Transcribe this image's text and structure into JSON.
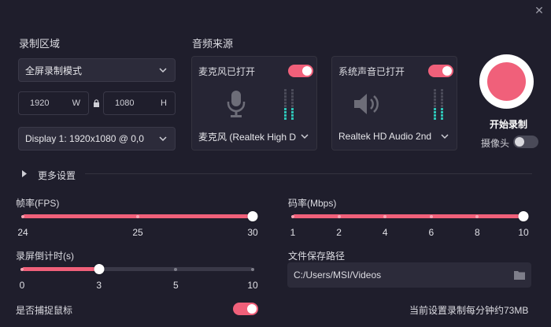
{
  "recording": {
    "section_title": "录制区域",
    "mode": "全屏录制模式",
    "width": "1920",
    "width_unit": "W",
    "height": "1080",
    "height_unit": "H",
    "display": "Display 1: 1920x1080 @ 0,0"
  },
  "audio": {
    "section_title": "音频来源",
    "mic": {
      "status": "麦克风已打开",
      "enabled": true,
      "device": "麦克风 (Realtek High D"
    },
    "system": {
      "status": "系统声音已打开",
      "enabled": true,
      "device": "Realtek HD Audio 2nd"
    }
  },
  "record": {
    "label": "开始录制",
    "camera_label": "摄像头",
    "camera_enabled": false
  },
  "more_settings": {
    "label": "更多设置"
  },
  "fps": {
    "label": "帧率(FPS)",
    "ticks": [
      "24",
      "25",
      "30"
    ],
    "value": "30"
  },
  "bitrate": {
    "label": "码率(Mbps)",
    "ticks": [
      "1",
      "2",
      "4",
      "6",
      "8",
      "10"
    ],
    "value": "10"
  },
  "countdown": {
    "label": "录屏倒计时(s)",
    "ticks": [
      "0",
      "3",
      "5",
      "10"
    ],
    "value": "3"
  },
  "save_path": {
    "label": "文件保存路径",
    "value": "C:/Users/MSI/Videos"
  },
  "capture_mouse": {
    "label": "是否捕捉鼠标",
    "enabled": true
  },
  "estimate": "当前设置录制每分钟约73MB",
  "colors": {
    "accent": "#f0607a",
    "background": "#1f1e2c",
    "meter": "#2ec4b6"
  }
}
